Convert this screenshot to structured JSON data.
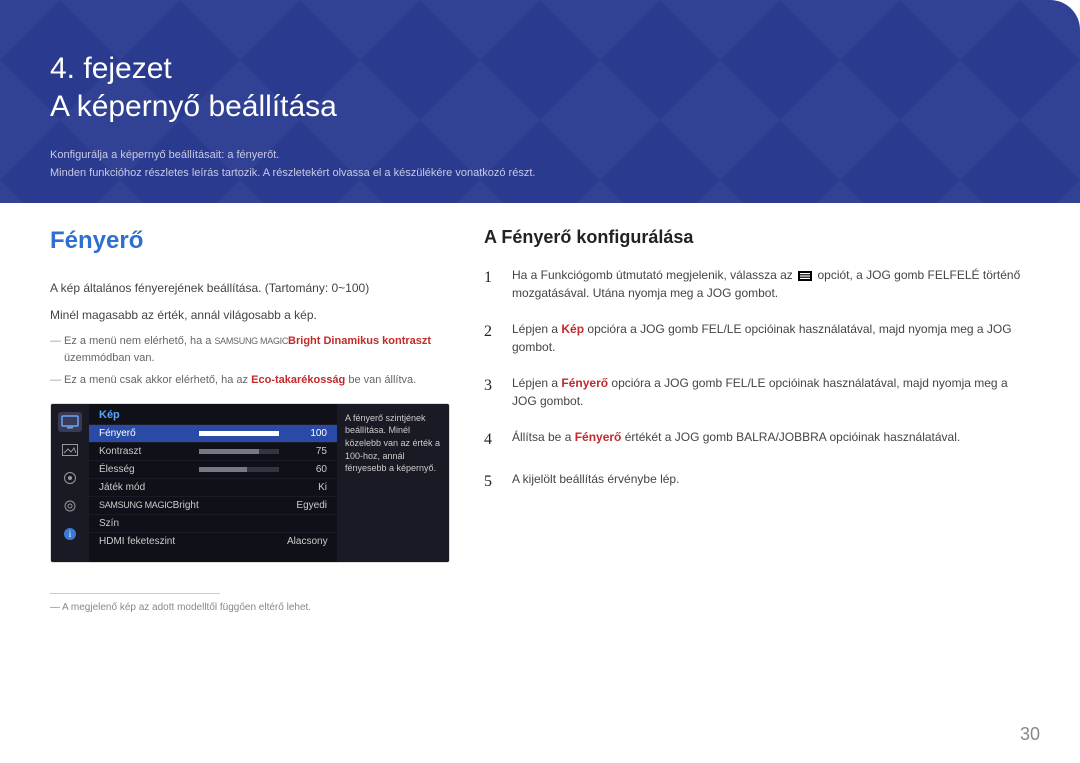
{
  "banner": {
    "chapter": "4. fejezet",
    "title": "A képernyő beállítása",
    "sub1": "Konfigurálja a képernyő beállításait: a fényerőt.",
    "sub2": "Minden funkcióhoz részletes leírás tartozik. A részletekért olvassa el a készülékére vonatkozó részt."
  },
  "left": {
    "h2": "Fényerő",
    "p1": "A kép általános fényerejének beállítása. (Tartomány: 0~100)",
    "p2": "Minél magasabb az érték, annál világosabb a kép.",
    "note1_a": "Ez a menü nem elérhető, ha a ",
    "note1_magic": "SAMSUNG MAGIC",
    "note1_b": "Bright Dinamikus kontraszt",
    "note1_c": " üzemmódban van.",
    "note2_a": "Ez a menü csak akkor elérhető, ha az ",
    "note2_b": "Eco-takarékosság",
    "note2_c": " be van állítva.",
    "footnote": "A megjelenő kép az adott modelltől függően eltérő lehet."
  },
  "osd": {
    "tab": "Kép",
    "rows": [
      {
        "label": "Fényerő",
        "value": "100",
        "bar": 100,
        "selected": true
      },
      {
        "label": "Kontraszt",
        "value": "75",
        "bar": 75
      },
      {
        "label": "Élesség",
        "value": "60",
        "bar": 60
      },
      {
        "label": "Játék mód",
        "value": "Ki"
      },
      {
        "label_prefix": "SAMSUNG MAGIC",
        "label": "Bright",
        "value": "Egyedi"
      },
      {
        "label": "Szín",
        "value": ""
      },
      {
        "label": "HDMI feketeszint",
        "value": "Alacsony"
      }
    ],
    "help": "A fényerő szintjének beállítása. Minél közelebb van az érték a 100-hoz, annál fényesebb a képernyő."
  },
  "right": {
    "h2": "A Fényerő konfigurálása",
    "steps": [
      {
        "n": "1",
        "a": "Ha a Funkciógomb útmutató megjelenik, válassza az ",
        "b": " opciót, a JOG gomb FELFELÉ történő mozgatásával. Utána nyomja meg a JOG gombot."
      },
      {
        "n": "2",
        "a": "Lépjen a ",
        "em": "Kép",
        "b": " opcióra a JOG gomb FEL/LE opcióinak használatával, majd nyomja meg a JOG gombot."
      },
      {
        "n": "3",
        "a": "Lépjen a ",
        "em": "Fényerő",
        "b": " opcióra a JOG gomb FEL/LE opcióinak használatával, majd nyomja meg a JOG gombot."
      },
      {
        "n": "4",
        "a": "Állítsa be a ",
        "em": "Fényerő",
        "b": " értékét a JOG gomb BALRA/JOBBRA opcióinak használatával."
      },
      {
        "n": "5",
        "a": "A kijelölt beállítás érvénybe lép."
      }
    ]
  },
  "pagenum": "30"
}
